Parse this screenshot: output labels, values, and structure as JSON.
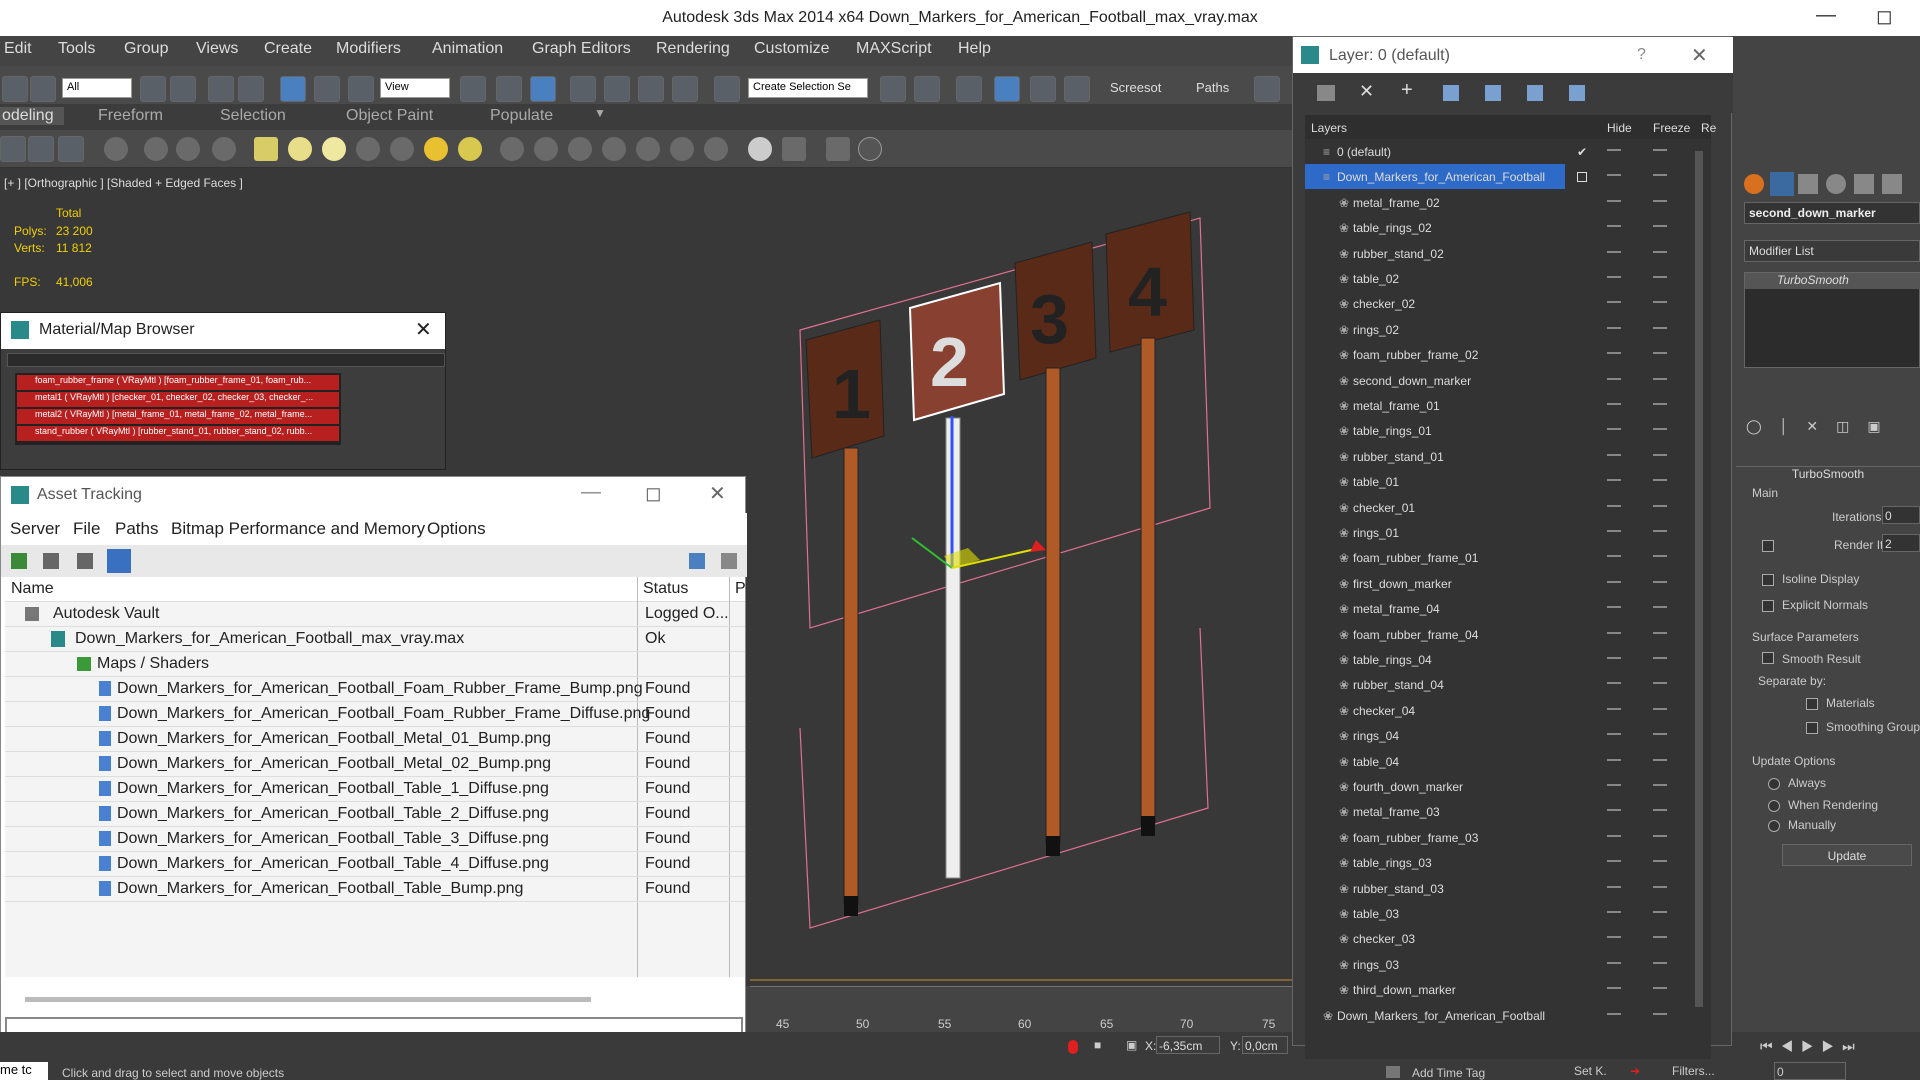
{
  "window": {
    "title": "Autodesk 3ds Max  2014 x64      Down_Markers_for_American_Football_max_vray.max"
  },
  "menu": [
    "Edit",
    "Tools",
    "Group",
    "Views",
    "Create",
    "Modifiers",
    "Animation",
    "Graph Editors",
    "Rendering",
    "Customize",
    "MAXScript",
    "Help"
  ],
  "toolbar": {
    "filter": "All",
    "refcoord": "View",
    "selset": "Create Selection Se",
    "screenshot": "Screesot",
    "paths": "Paths"
  },
  "ribbon": [
    "odeling",
    "Freeform",
    "Selection",
    "Object Paint",
    "Populate"
  ],
  "viewport": {
    "label": "[+ ] [Orthographic ] [Shaded + Edged Faces ]",
    "total": "Total",
    "polys_label": "Polys:",
    "polys": "23 200",
    "verts_label": "Verts:",
    "verts": "11 812",
    "fps_label": "FPS:",
    "fps": "41,006"
  },
  "material_browser": {
    "title": "Material/Map Browser",
    "items": [
      "foam_rubber_frame  ( VRayMtl ) [foam_rubber_frame_01, foam_rub...",
      "metal1  ( VRayMtl )  [checker_01, checker_02, checker_03, checker_...",
      "metal2  ( VRayMtl )  [metal_frame_01, metal_frame_02, metal_frame...",
      "stand_rubber  ( VRayMtl ) [rubber_stand_01, rubber_stand_02, rubb..."
    ]
  },
  "asset_tracking": {
    "title": "Asset Tracking",
    "menu": [
      "Server",
      "File",
      "Paths",
      "Bitmap Performance and Memory",
      "Options"
    ],
    "col_name": "Name",
    "col_status": "Status",
    "col_p": "P",
    "rows": [
      {
        "name": "Autodesk Vault",
        "status": "Logged O..."
      },
      {
        "name": "Down_Markers_for_American_Football_max_vray.max",
        "status": "Ok"
      },
      {
        "name": "Maps / Shaders",
        "status": ""
      },
      {
        "name": "Down_Markers_for_American_Football_Foam_Rubber_Frame_Bump.png",
        "status": "Found"
      },
      {
        "name": "Down_Markers_for_American_Football_Foam_Rubber_Frame_Diffuse.png",
        "status": "Found"
      },
      {
        "name": "Down_Markers_for_American_Football_Metal_01_Bump.png",
        "status": "Found"
      },
      {
        "name": "Down_Markers_for_American_Football_Metal_02_Bump.png",
        "status": "Found"
      },
      {
        "name": "Down_Markers_for_American_Football_Table_1_Diffuse.png",
        "status": "Found"
      },
      {
        "name": "Down_Markers_for_American_Football_Table_2_Diffuse.png",
        "status": "Found"
      },
      {
        "name": "Down_Markers_for_American_Football_Table_3_Diffuse.png",
        "status": "Found"
      },
      {
        "name": "Down_Markers_for_American_Football_Table_4_Diffuse.png",
        "status": "Found"
      },
      {
        "name": "Down_Markers_for_American_Football_Table_Bump.png",
        "status": "Found"
      }
    ]
  },
  "layers": {
    "title": "Layer: 0 (default)",
    "help": "?",
    "col_layers": "Layers",
    "col_hide": "Hide",
    "col_freeze": "Freeze",
    "col_r": "Re",
    "items": [
      "0 (default)",
      "Down_Markers_for_American_Football",
      "metal_frame_02",
      "table_rings_02",
      "rubber_stand_02",
      "table_02",
      "checker_02",
      "rings_02",
      "foam_rubber_frame_02",
      "second_down_marker",
      "metal_frame_01",
      "table_rings_01",
      "rubber_stand_01",
      "table_01",
      "checker_01",
      "rings_01",
      "foam_rubber_frame_01",
      "first_down_marker",
      "metal_frame_04",
      "foam_rubber_frame_04",
      "table_rings_04",
      "rubber_stand_04",
      "checker_04",
      "rings_04",
      "table_04",
      "fourth_down_marker",
      "metal_frame_03",
      "foam_rubber_frame_03",
      "table_rings_03",
      "rubber_stand_03",
      "table_03",
      "checker_03",
      "rings_03",
      "third_down_marker",
      "Down_Markers_for_American_Football"
    ]
  },
  "command_panel": {
    "object_name": "second_down_marker",
    "modifier_list": "Modifier List",
    "stack_item": "TurboSmooth",
    "rollout": "TurboSmooth",
    "main": "Main",
    "iterations_label": "Iterations:",
    "iterations": "0",
    "render_iters_label": "Render Iters:",
    "render_iters": "2",
    "isoline": "Isoline Display",
    "explicit": "Explicit Normals",
    "surface": "Surface Parameters",
    "smooth_result": "Smooth Result",
    "separate_by": "Separate by:",
    "materials": "Materials",
    "smoothing_groups": "Smoothing Groups",
    "update_options": "Update Options",
    "always": "Always",
    "when_rendering": "When Rendering",
    "manually": "Manually",
    "update_btn": "Update"
  },
  "timeline": {
    "ticks": [
      "45",
      "50",
      "55",
      "60",
      "65",
      "70",
      "75"
    ]
  },
  "status": {
    "prompt": "Click and drag to select and move objects",
    "script": "me  tc",
    "x_label": "X:",
    "x": "-6,35cm",
    "y_label": "Y:",
    "y": "0,0cm",
    "add_time_tag": "Add Time Tag",
    "set_k": "Set K.",
    "filters": "Filters...",
    "frame": "0"
  }
}
